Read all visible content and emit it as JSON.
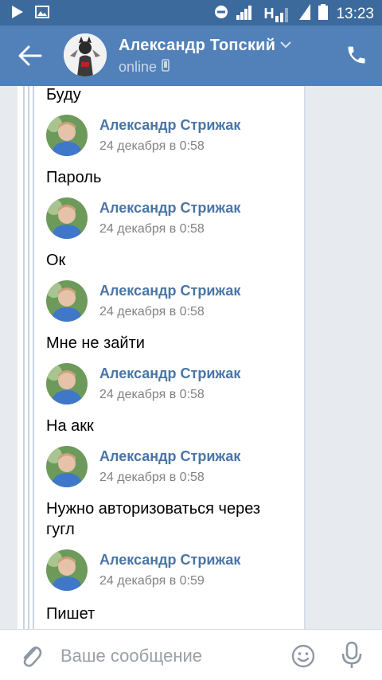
{
  "statusbar": {
    "time": "13:23",
    "network": "H"
  },
  "header": {
    "name": "Александр Топский",
    "status": "online"
  },
  "messages": [
    {
      "text": "Буду"
    },
    {
      "sender": "Александр Стрижак",
      "date": "24 декабря в 0:58",
      "text": "Пароль"
    },
    {
      "sender": "Александр Стрижак",
      "date": "24 декабря в 0:58",
      "text": "Ок"
    },
    {
      "sender": "Александр Стрижак",
      "date": "24 декабря в 0:58",
      "text": "Мне не зайти"
    },
    {
      "sender": "Александр Стрижак",
      "date": "24 декабря в 0:58",
      "text": "На акк"
    },
    {
      "sender": "Александр Стрижак",
      "date": "24 декабря в 0:58",
      "text": "Нужно авторизоваться через гугл"
    },
    {
      "sender": "Александр Стрижак",
      "date": "24 декабря в 0:59",
      "text": "Пишет"
    }
  ],
  "composer": {
    "placeholder": "Ваше сообщение"
  },
  "colors": {
    "header": "#5181b8",
    "statusbar": "#3d6a9c",
    "link": "#4a75a6",
    "date": "#828282"
  }
}
